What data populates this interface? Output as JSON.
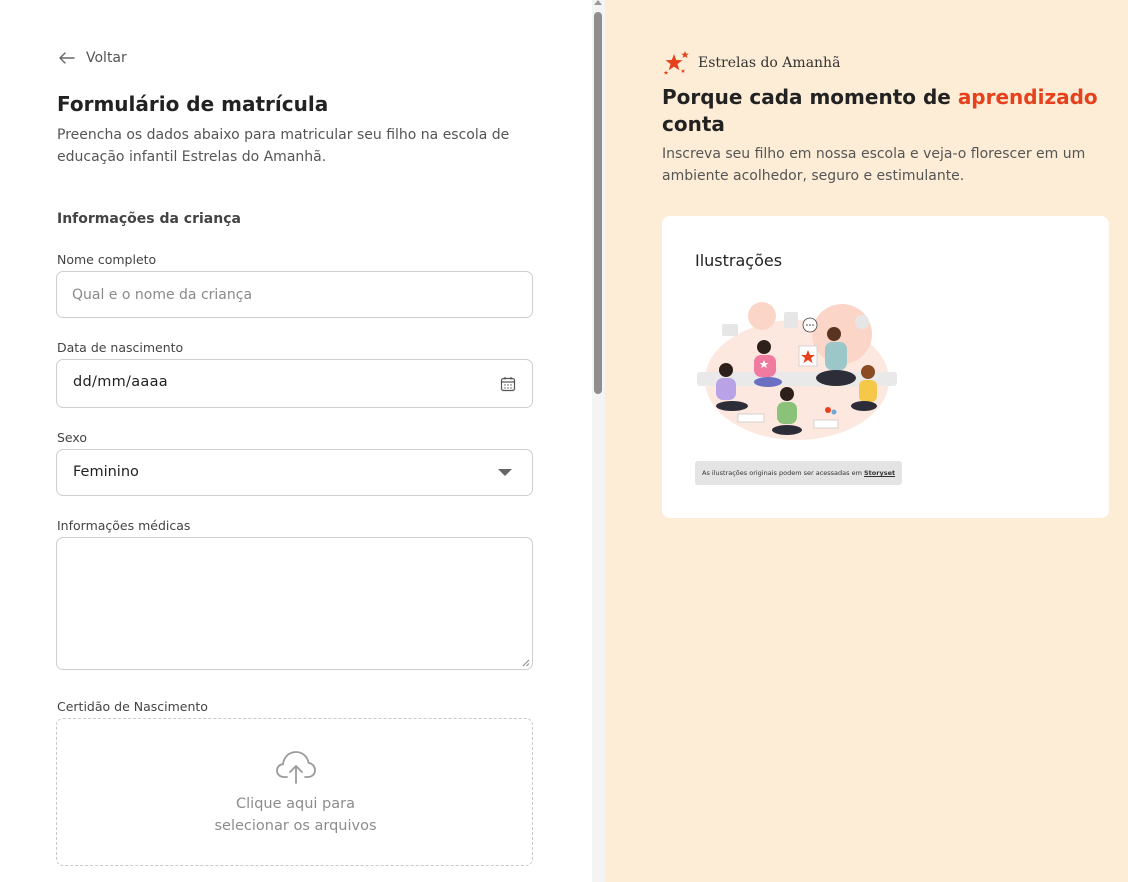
{
  "form": {
    "back_label": "Voltar",
    "title": "Formulário de matrícula",
    "subtitle": "Preencha os dados abaixo para matricular seu filho na escola de educação infantil Estrelas do Amanhã.",
    "section_title": "Informações da criança",
    "fields": {
      "name": {
        "label": "Nome completo",
        "placeholder": "Qual e o nome da criança",
        "value": ""
      },
      "birthdate": {
        "label": "Data de nascimento",
        "value": "dd/mm/aaaa"
      },
      "sex": {
        "label": "Sexo",
        "value": "Feminino"
      },
      "medical": {
        "label": "Informações médicas",
        "value": ""
      },
      "certificate": {
        "label": "Certidão de Nascimento",
        "upload_line1": "Clique aqui para",
        "upload_line2": "selecionar os arquivos"
      }
    }
  },
  "aside": {
    "brand_name": "Estrelas do Amanhã",
    "headline_part1": "Porque cada momento de ",
    "headline_accent": "aprendizado",
    "headline_part2": " conta",
    "description": "Inscreva seu filho em nossa escola e veja-o florescer em um ambiente acolhedor, seguro e estimulante.",
    "card": {
      "title": "Ilustrações",
      "credit_text": "As ilustrações originais podem ser acessadas em ",
      "credit_link": "Storyset"
    }
  },
  "colors": {
    "accent": "#e7401c",
    "aside_background": "#fdedd7",
    "text": "#2b2b2b",
    "muted": "#555555"
  },
  "icons": [
    "arrow-left-icon",
    "calendar-icon",
    "chevron-down-icon",
    "cloud-upload-icon",
    "star-logo-icon"
  ]
}
